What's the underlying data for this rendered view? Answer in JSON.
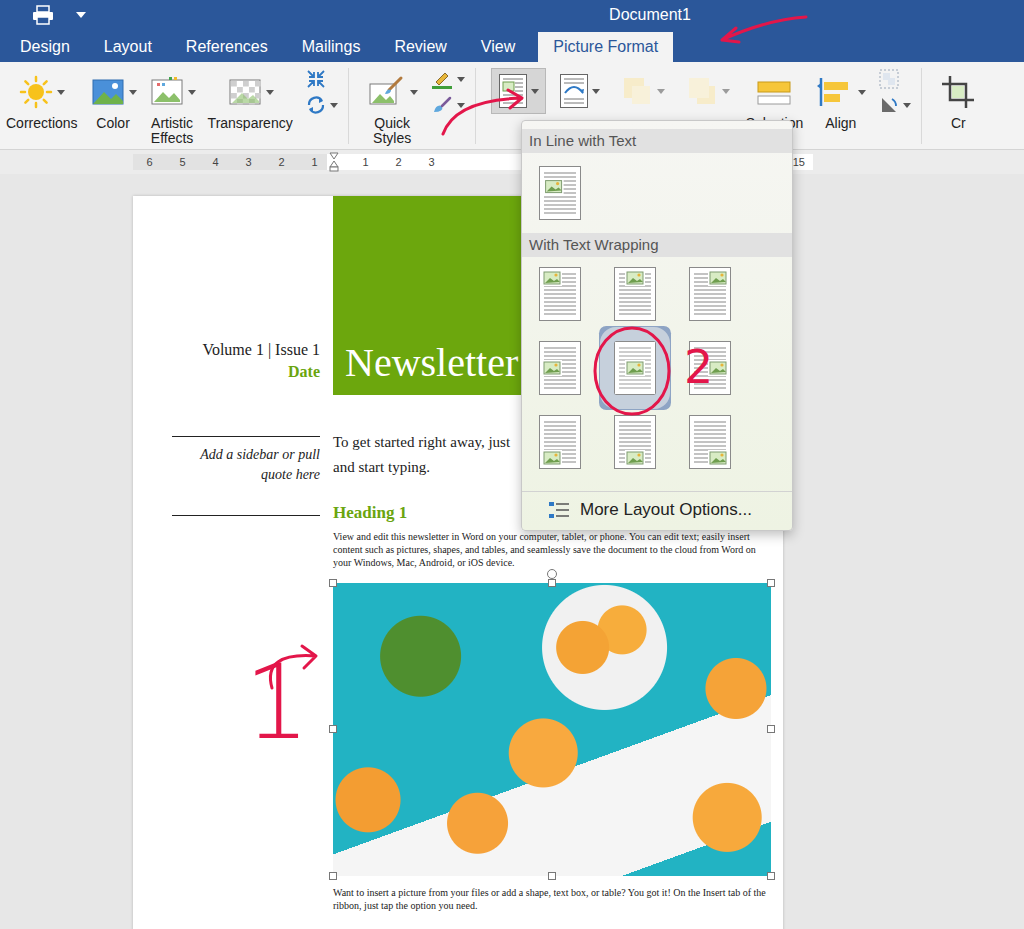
{
  "window": {
    "title": "Document1"
  },
  "tabs": [
    {
      "label": "Design",
      "selected": false
    },
    {
      "label": "Layout",
      "selected": false
    },
    {
      "label": "References",
      "selected": false
    },
    {
      "label": "Mailings",
      "selected": false
    },
    {
      "label": "Review",
      "selected": false
    },
    {
      "label": "View",
      "selected": false
    },
    {
      "label": "Picture Format",
      "selected": true
    }
  ],
  "ribbon": {
    "items": [
      {
        "kind": "split",
        "label": "Corrections",
        "disabled": false,
        "open": false
      },
      {
        "kind": "split",
        "label": "Color",
        "disabled": false,
        "open": false
      },
      {
        "kind": "split",
        "label": "Artistic Effects",
        "disabled": false,
        "open": false
      },
      {
        "kind": "split",
        "label": "Transparency",
        "disabled": false,
        "open": false
      },
      {
        "kind": "pair",
        "disabled": false,
        "open": false
      },
      {
        "kind": "split",
        "label": "Quick Styles",
        "disabled": false,
        "open": false
      },
      {
        "kind": "pair",
        "disabled": false,
        "open": false
      },
      {
        "kind": "menu",
        "disabled": false,
        "open": true
      },
      {
        "kind": "menu",
        "disabled": false,
        "open": false
      },
      {
        "kind": "menu",
        "disabled": true,
        "open": false
      },
      {
        "kind": "menu",
        "disabled": true,
        "open": false
      },
      {
        "kind": "large",
        "label": "Selection Pane",
        "disabled": false,
        "open": false
      },
      {
        "kind": "split",
        "label": "Align",
        "disabled": false,
        "open": false
      },
      {
        "kind": "pair",
        "disabled": false,
        "open": false
      },
      {
        "kind": "large",
        "label": "Cr",
        "disabled": false,
        "open": false
      }
    ]
  },
  "ruler": {
    "left": [
      "6",
      "5",
      "4",
      "3",
      "2",
      "1"
    ],
    "right": [
      "1",
      "2",
      "3"
    ],
    "end": "15"
  },
  "wrap_menu": {
    "sections": [
      {
        "title": "In Line with Text",
        "options": [
          {
            "selected": false
          }
        ]
      },
      {
        "title": "With Text Wrapping",
        "options": [
          {
            "selected": false
          },
          {
            "selected": false
          },
          {
            "selected": false
          },
          {
            "selected": false
          },
          {
            "selected": true
          },
          {
            "selected": false
          },
          {
            "selected": false
          },
          {
            "selected": false
          },
          {
            "selected": false
          }
        ]
      }
    ],
    "more": "More Layout Options..."
  },
  "document": {
    "issue": "Volume 1 | Issue 1",
    "date": "Date",
    "title": "Newsletter",
    "sidebar": "Add a sidebar or pull quote here",
    "intro": [
      "To get started right away, just",
      "and start typing."
    ],
    "heading": "Heading 1",
    "body": "View and edit this newsletter in Word on your computer, tablet, or phone. You can edit text; easily insert content such as pictures, shapes, and tables, and seamlessly save the document to the cloud from Word on your Windows, Mac, Android, or iOS device.",
    "picture": {
      "selected": true
    },
    "caption": "Want to insert a picture from your files or add a shape, text box, or table? You got it! On the Insert tab of the ribbon, just tap the option you need."
  },
  "annotations": [
    {
      "text": "1"
    },
    {
      "text": "2"
    }
  ]
}
